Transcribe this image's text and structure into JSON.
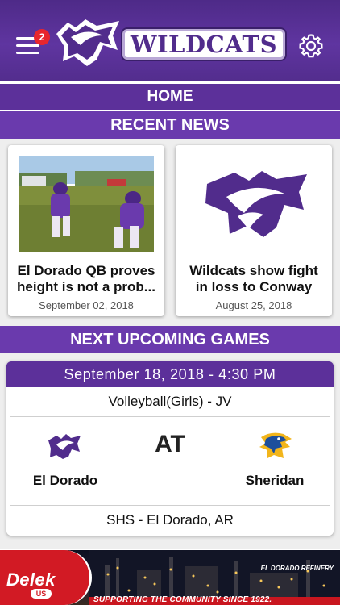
{
  "header": {
    "menu_badge": "2",
    "brand": "WILDCATS",
    "icons": [
      "hamburger-menu-icon",
      "gear-icon"
    ]
  },
  "nav": {
    "home_label": "HOME"
  },
  "recent_news": {
    "heading": "RECENT NEWS",
    "articles": [
      {
        "title_line1": "El Dorado QB proves",
        "title_line2": "height is not a prob...",
        "date": "September 02, 2018"
      },
      {
        "title_line1": "Wildcats show fight",
        "title_line2": "in loss to Conway",
        "date": "August 25, 2018"
      }
    ]
  },
  "upcoming": {
    "heading": "NEXT UPCOMING GAMES",
    "game": {
      "datetime": "September 18, 2018 - 4:30 PM",
      "sport": "Volleyball(Girls) - JV",
      "separator": "AT",
      "home_team": "El Dorado",
      "away_team": "Sheridan",
      "venue": "SHS - El Dorado, AR"
    }
  },
  "ad": {
    "brand": "Delek",
    "brand_sub": "US",
    "caption": "EL DORADO REFINERY",
    "slogan": "SUPPORTING THE COMMUNITY SINCE 1922."
  },
  "colors": {
    "purple": "#5c309a",
    "purple_light": "#6a3aad",
    "badge_red": "#e8262d",
    "ad_red": "#d21a24"
  }
}
